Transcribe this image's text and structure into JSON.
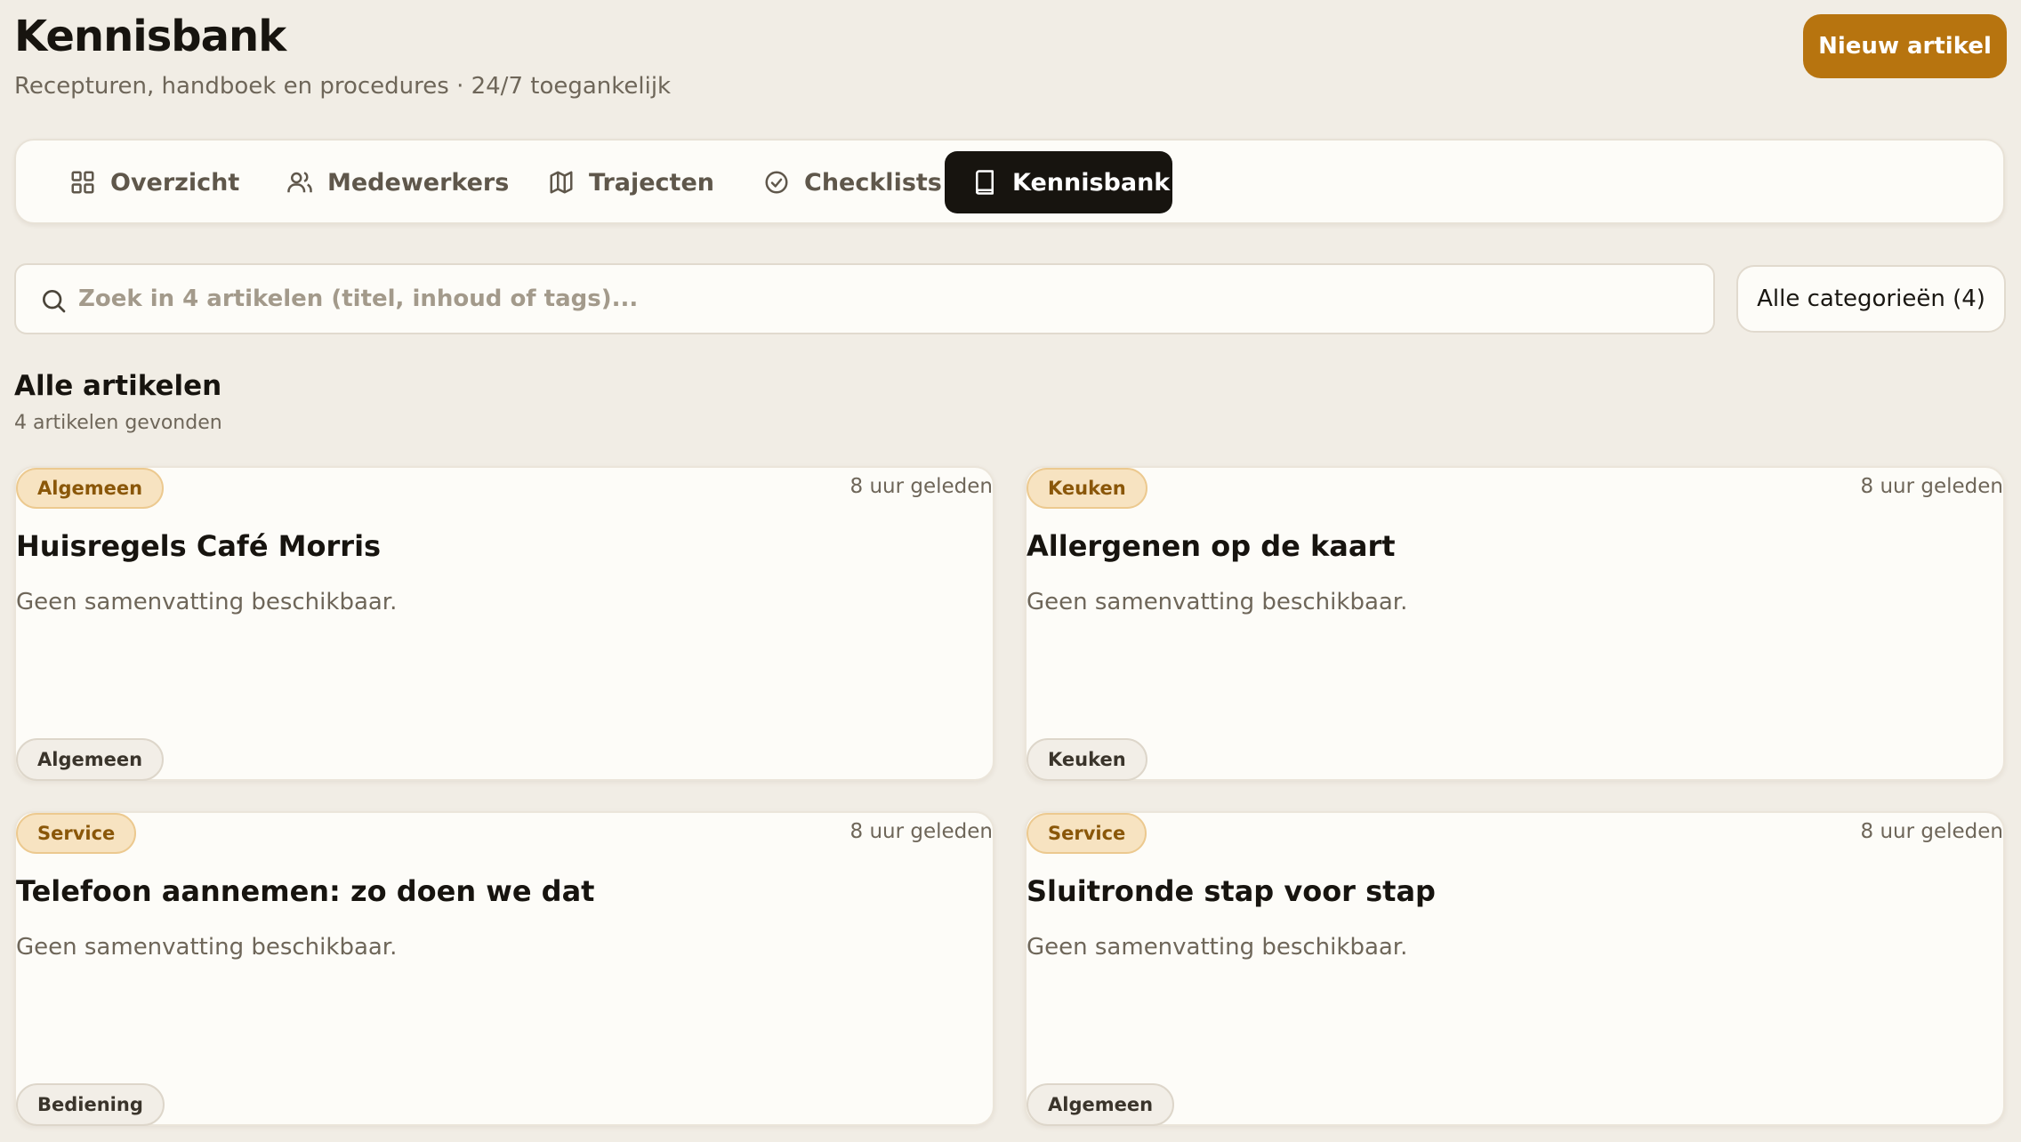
{
  "header": {
    "title": "Kennisbank",
    "subtitle": "Recepturen, handboek en procedures · 24/7 toegankelijk",
    "new_article_label": "Nieuw artikel"
  },
  "nav": {
    "tabs": [
      {
        "label": "Overzicht",
        "icon": "grid-icon",
        "active": false
      },
      {
        "label": "Medewerkers",
        "icon": "users-icon",
        "active": false
      },
      {
        "label": "Trajecten",
        "icon": "map-icon",
        "active": false
      },
      {
        "label": "Checklists",
        "icon": "check-circle-icon",
        "active": false
      },
      {
        "label": "Kennisbank",
        "icon": "book-icon",
        "active": true
      }
    ]
  },
  "search": {
    "placeholder": "Zoek in 4 artikelen (titel, inhoud of tags)...",
    "value": ""
  },
  "filter": {
    "category_label": "Alle categorieën (4)"
  },
  "section": {
    "title": "Alle artikelen",
    "count": "4 artikelen gevonden"
  },
  "articles": [
    {
      "category": "Algemeen",
      "time": "8 uur geleden",
      "title": "Huisregels Café Morris",
      "summary": "Geen samenvatting beschikbaar.",
      "tag": "Algemeen"
    },
    {
      "category": "Keuken",
      "time": "8 uur geleden",
      "title": "Allergenen op de kaart",
      "summary": "Geen samenvatting beschikbaar.",
      "tag": "Keuken"
    },
    {
      "category": "Service",
      "time": "8 uur geleden",
      "title": "Telefoon aannemen: zo doen we dat",
      "summary": "Geen samenvatting beschikbaar.",
      "tag": "Bediening"
    },
    {
      "category": "Service",
      "time": "8 uur geleden",
      "title": "Sluitronde stap voor stap",
      "summary": "Geen samenvatting beschikbaar.",
      "tag": "Algemeen"
    }
  ],
  "colors": {
    "background": "#f1ede5",
    "accent": "#b7740f",
    "active_tab": "#17140f",
    "category_badge": "#f7e3c1",
    "category_badge_text": "#8a5709"
  }
}
